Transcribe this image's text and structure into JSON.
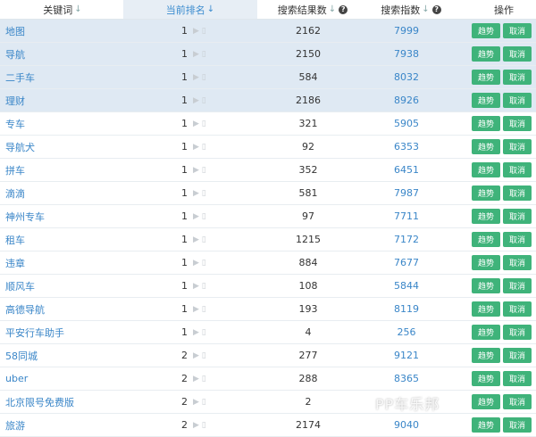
{
  "header": {
    "keyword": "关键词",
    "current_rank": "当前排名",
    "search_results": "搜索结果数",
    "search_index": "搜索指数",
    "operations": "操作"
  },
  "buttons": {
    "trend": "趋势",
    "cancel": "取消"
  },
  "rows": [
    {
      "keyword": "地图",
      "rank": "1",
      "results": "2162",
      "index": "7999",
      "highlight": true
    },
    {
      "keyword": "导航",
      "rank": "1",
      "results": "2150",
      "index": "7938",
      "highlight": true
    },
    {
      "keyword": "二手车",
      "rank": "1",
      "results": "584",
      "index": "8032",
      "highlight": true
    },
    {
      "keyword": "理财",
      "rank": "1",
      "results": "2186",
      "index": "8926",
      "highlight": true
    },
    {
      "keyword": "专车",
      "rank": "1",
      "results": "321",
      "index": "5905",
      "highlight": false
    },
    {
      "keyword": "导航犬",
      "rank": "1",
      "results": "92",
      "index": "6353",
      "highlight": false
    },
    {
      "keyword": "拼车",
      "rank": "1",
      "results": "352",
      "index": "6451",
      "highlight": false
    },
    {
      "keyword": "滴滴",
      "rank": "1",
      "results": "581",
      "index": "7987",
      "highlight": false
    },
    {
      "keyword": "神州专车",
      "rank": "1",
      "results": "97",
      "index": "7711",
      "highlight": false
    },
    {
      "keyword": "租车",
      "rank": "1",
      "results": "1215",
      "index": "7172",
      "highlight": false
    },
    {
      "keyword": "违章",
      "rank": "1",
      "results": "884",
      "index": "7677",
      "highlight": false
    },
    {
      "keyword": "顺风车",
      "rank": "1",
      "results": "108",
      "index": "5844",
      "highlight": false
    },
    {
      "keyword": "高德导航",
      "rank": "1",
      "results": "193",
      "index": "8119",
      "highlight": false
    },
    {
      "keyword": "平安行车助手",
      "rank": "1",
      "results": "4",
      "index": "256",
      "highlight": false
    },
    {
      "keyword": "58同城",
      "rank": "2",
      "results": "277",
      "index": "9121",
      "highlight": false
    },
    {
      "keyword": "uber",
      "rank": "2",
      "results": "288",
      "index": "8365",
      "highlight": false
    },
    {
      "keyword": "北京限号免费版",
      "rank": "2",
      "results": "2",
      "index": "",
      "highlight": false
    },
    {
      "keyword": "旅游",
      "rank": "2",
      "results": "2174",
      "index": "9040",
      "highlight": false
    }
  ],
  "watermark": "PP车乐邦"
}
